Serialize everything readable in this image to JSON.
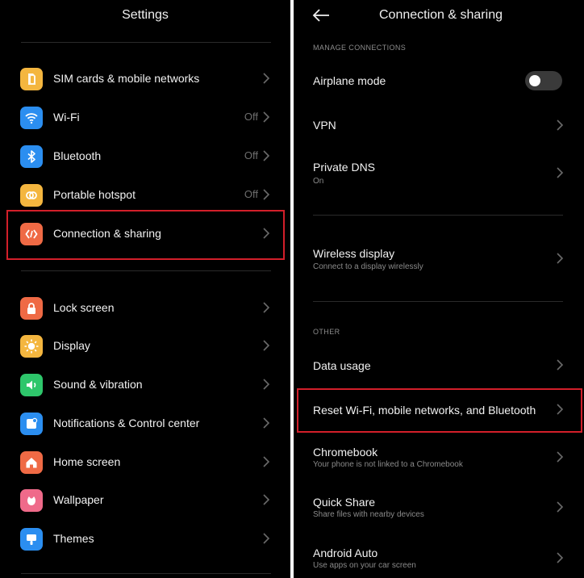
{
  "left": {
    "title": "Settings",
    "items": [
      {
        "label": "SIM cards & mobile networks",
        "value": "",
        "icon": "sim-card-icon",
        "color": "#f4b63f"
      },
      {
        "label": "Wi-Fi",
        "value": "Off",
        "icon": "wifi-icon",
        "color": "#2b8ef0"
      },
      {
        "label": "Bluetooth",
        "value": "Off",
        "icon": "bluetooth-icon",
        "color": "#2b8ef0"
      },
      {
        "label": "Portable hotspot",
        "value": "Off",
        "icon": "hotspot-icon",
        "color": "#f4b63f"
      },
      {
        "label": "Connection & sharing",
        "value": "",
        "icon": "connection-sharing-icon",
        "color": "#ef6a45"
      },
      {
        "label": "Lock screen",
        "value": "",
        "icon": "lock-icon",
        "color": "#ef6a45"
      },
      {
        "label": "Display",
        "value": "",
        "icon": "sun-icon",
        "color": "#f4b63f"
      },
      {
        "label": "Sound & vibration",
        "value": "",
        "icon": "speaker-icon",
        "color": "#2ec66b"
      },
      {
        "label": "Notifications & Control center",
        "value": "",
        "icon": "notification-icon",
        "color": "#2b8ef0"
      },
      {
        "label": "Home screen",
        "value": "",
        "icon": "home-icon",
        "color": "#ef6a45"
      },
      {
        "label": "Wallpaper",
        "value": "",
        "icon": "wallpaper-icon",
        "color": "#ef6a8a"
      },
      {
        "label": "Themes",
        "value": "",
        "icon": "themes-icon",
        "color": "#2b8ef0"
      }
    ]
  },
  "right": {
    "title": "Connection & sharing",
    "section_manage": "MANAGE CONNECTIONS",
    "section_other": "OTHER",
    "airplane": {
      "label": "Airplane mode",
      "enabled": false
    },
    "vpn": {
      "label": "VPN"
    },
    "private_dns": {
      "label": "Private DNS",
      "sub": "On"
    },
    "wireless_display": {
      "label": "Wireless display",
      "sub": "Connect to a display wirelessly"
    },
    "data_usage": {
      "label": "Data usage"
    },
    "reset": {
      "label": "Reset Wi-Fi, mobile networks, and Bluetooth"
    },
    "chromebook": {
      "label": "Chromebook",
      "sub": "Your phone is not linked to a Chromebook"
    },
    "quick_share": {
      "label": "Quick Share",
      "sub": "Share files with nearby devices"
    },
    "android_auto": {
      "label": "Android Auto",
      "sub": "Use apps on your car screen"
    }
  },
  "highlight_color": "#d21f2a"
}
